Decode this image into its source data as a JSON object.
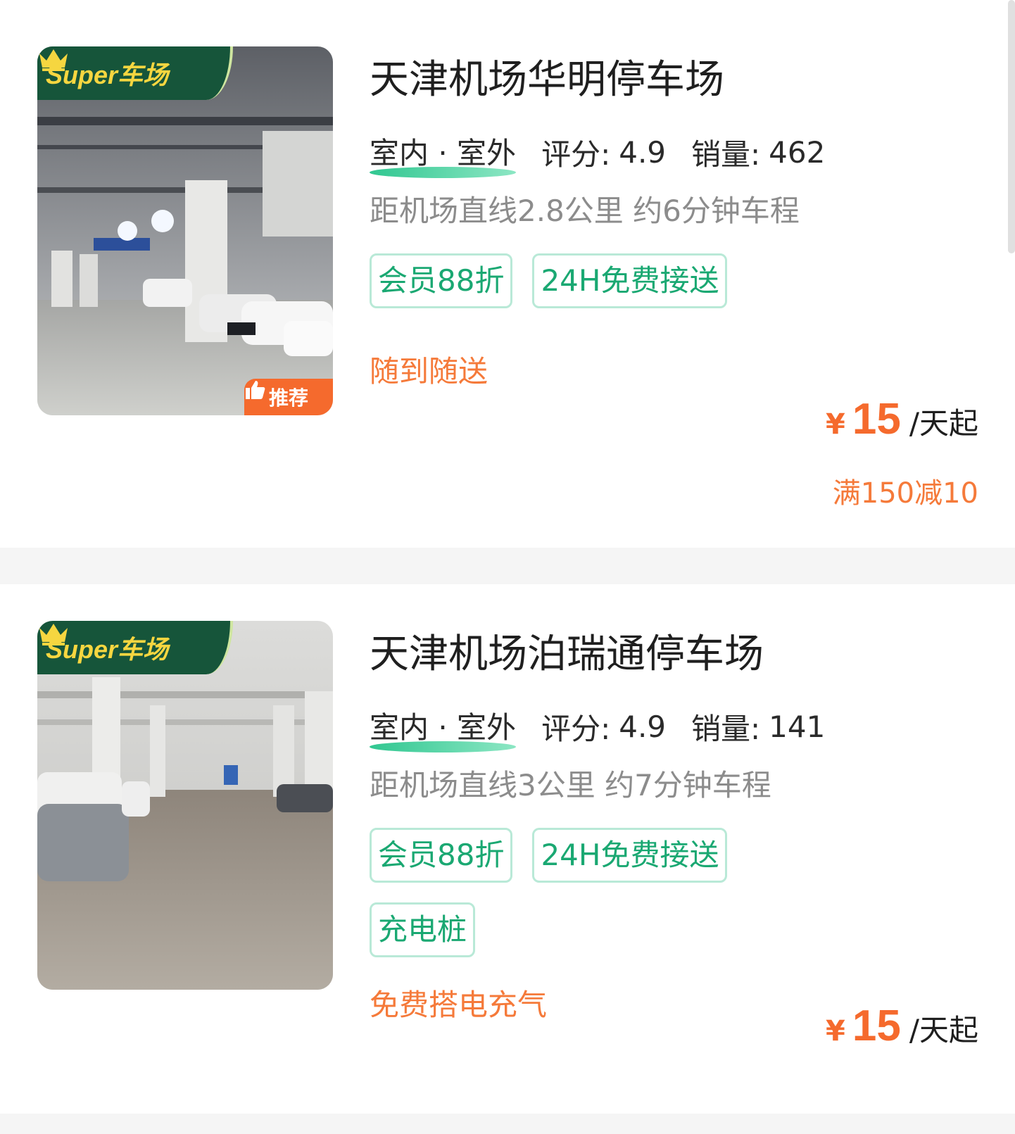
{
  "super_badge_text": "Super车场",
  "recommend_badge_text": "推荐",
  "currency": "¥",
  "colors": {
    "brand_green": "#16553a",
    "tag_green": "#1aa872",
    "accent_orange": "#f56a2d",
    "badge_gold": "#f6d640"
  },
  "lots": [
    {
      "name": "天津机场华明停车场",
      "env_type": "室内 · 室外",
      "rating_label": "评分:",
      "rating": "4.9",
      "sales_label": "销量:",
      "sales": "462",
      "distance": "距机场直线2.8公里 约6分钟车程",
      "tags": [
        "会员88折",
        "24H免费接送"
      ],
      "note": "随到随送",
      "price": "15",
      "price_unit": "/天起",
      "promo": "满150减10",
      "recommended": true
    },
    {
      "name": "天津机场泊瑞通停车场",
      "env_type": "室内 · 室外",
      "rating_label": "评分:",
      "rating": "4.9",
      "sales_label": "销量:",
      "sales": "141",
      "distance": "距机场直线3公里 约7分钟车程",
      "tags": [
        "会员88折",
        "24H免费接送",
        "充电桩"
      ],
      "note": "免费搭电充气",
      "price": "15",
      "price_unit": "/天起",
      "recommended": false
    }
  ]
}
